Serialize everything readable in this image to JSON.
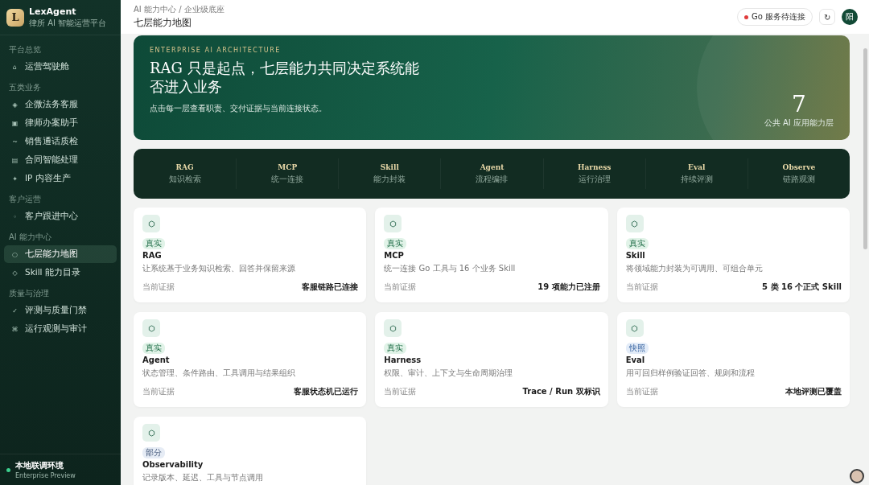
{
  "brand": {
    "logo": "L",
    "name": "LexAgent",
    "subtitle": "律所 AI 智能运营平台"
  },
  "sidebar": {
    "sections": [
      {
        "label": "平台总览",
        "items": [
          {
            "icon": "⌂",
            "label": "运营驾驶舱",
            "selected": false
          }
        ]
      },
      {
        "label": "五类业务",
        "items": [
          {
            "icon": "◈",
            "label": "企微法务客服",
            "selected": false
          },
          {
            "icon": "▣",
            "label": "律师办案助手",
            "selected": false
          },
          {
            "icon": "~",
            "label": "销售通话质检",
            "selected": false
          },
          {
            "icon": "▤",
            "label": "合同智能处理",
            "selected": false
          },
          {
            "icon": "✦",
            "label": "IP 内容生产",
            "selected": false
          }
        ]
      },
      {
        "label": "客户运营",
        "items": [
          {
            "icon": "◦",
            "label": "客户跟进中心",
            "selected": false
          }
        ]
      },
      {
        "label": "AI 能力中心",
        "items": [
          {
            "icon": "○",
            "label": "七层能力地图",
            "selected": true
          },
          {
            "icon": "◇",
            "label": "Skill 能力目录",
            "selected": false
          }
        ]
      },
      {
        "label": "质量与治理",
        "items": [
          {
            "icon": "✓",
            "label": "评测与质量门禁",
            "selected": false
          },
          {
            "icon": "⌘",
            "label": "运行观测与审计",
            "selected": false
          }
        ]
      }
    ],
    "footer": {
      "env": "本地联调环境",
      "edition": "Enterprise Preview",
      "online": true
    }
  },
  "header": {
    "breadcrumb": "AI 能力中心 / 企业级底座",
    "title": "七层能力地图",
    "status": {
      "label": "Go 服务待连接",
      "connected": false
    },
    "refresh": "↻",
    "avatar": "阳"
  },
  "hero": {
    "eyebrow": "ENTERPRISE AI ARCHITECTURE",
    "title": "RAG 只是起点，七层能力共同决定系统能否进入业务",
    "subtitle": "点击每一层查看职责、交付证据与当前连接状态。",
    "count": "7",
    "count_label": "公共 AI 应用能力层"
  },
  "layers": [
    {
      "name": "RAG",
      "sub": "知识检索"
    },
    {
      "name": "MCP",
      "sub": "统一连接"
    },
    {
      "name": "Skill",
      "sub": "能力封装"
    },
    {
      "name": "Agent",
      "sub": "流程编排"
    },
    {
      "name": "Harness",
      "sub": "运行治理"
    },
    {
      "name": "Eval",
      "sub": "持续评测"
    },
    {
      "name": "Observe",
      "sub": "链路观测"
    }
  ],
  "cards": [
    {
      "badge": "真实",
      "kind": "real",
      "title": "RAG",
      "desc": "让系统基于业务知识检索、回答并保留来源",
      "evidence_label": "当前证据",
      "evidence": "客服链路已连接"
    },
    {
      "badge": "真实",
      "kind": "real",
      "title": "MCP",
      "desc": "统一连接 Go 工具与 16 个业务 Skill",
      "evidence_label": "当前证据",
      "evidence": "19 项能力已注册"
    },
    {
      "badge": "真实",
      "kind": "real",
      "title": "Skill",
      "desc": "将领域能力封装为可调用、可组合单元",
      "evidence_label": "当前证据",
      "evidence": "5 类 16 个正式 Skill"
    },
    {
      "badge": "真实",
      "kind": "real",
      "title": "Agent",
      "desc": "状态管理、条件路由、工具调用与结果组织",
      "evidence_label": "当前证据",
      "evidence": "客服状态机已运行"
    },
    {
      "badge": "真实",
      "kind": "real",
      "title": "Harness",
      "desc": "权限、审计、上下文与生命周期治理",
      "evidence_label": "当前证据",
      "evidence": "Trace / Run 双标识"
    },
    {
      "badge": "快照",
      "kind": "snapshot",
      "title": "Eval",
      "desc": "用可回归样例验证回答、规则和流程",
      "evidence_label": "当前证据",
      "evidence": "本地评测已覆盖"
    },
    {
      "badge": "部分",
      "kind": "partial",
      "title": "Observability",
      "desc": "记录版本、延迟、工具与节点调用"
    }
  ]
}
